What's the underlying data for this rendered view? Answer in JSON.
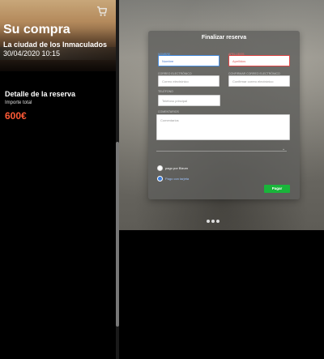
{
  "purchase": {
    "title": "Su compra",
    "movie": "La ciudad de los Inmaculados",
    "datetime": "30/04/2020 10:15",
    "cart_icon": "shopping-cart-icon",
    "detail_title": "Detalle de la reserva",
    "total_label": "Importe total",
    "total_value": "600€",
    "price_color": "#ff5a36"
  },
  "form": {
    "title": "Finalizar reserva",
    "name_label": "NOMBRE",
    "name_placeholder": "Nombre",
    "surname_label": "APELLIDOS",
    "surname_placeholder": "Apellidos",
    "email_label": "CORREO ELECTRÓNICO",
    "email_placeholder": "Correo electrónico",
    "confirm_email_label": "CONFIRMAR CORREO ELECTRÓNICO",
    "confirm_email_placeholder": "Confirmar correo electrónico",
    "phone_label": "TELÉFONO",
    "phone_placeholder": "Teléfono principal",
    "comments_label": "COMENTARIOS",
    "comments_placeholder": "Comentarios",
    "payment_option_1": "pago por Bizum",
    "payment_option_2": "Pago con tarjeta",
    "pay_button": "Pagar",
    "pay_color": "#19b53a"
  },
  "pagination": {
    "dot_count": 3
  }
}
